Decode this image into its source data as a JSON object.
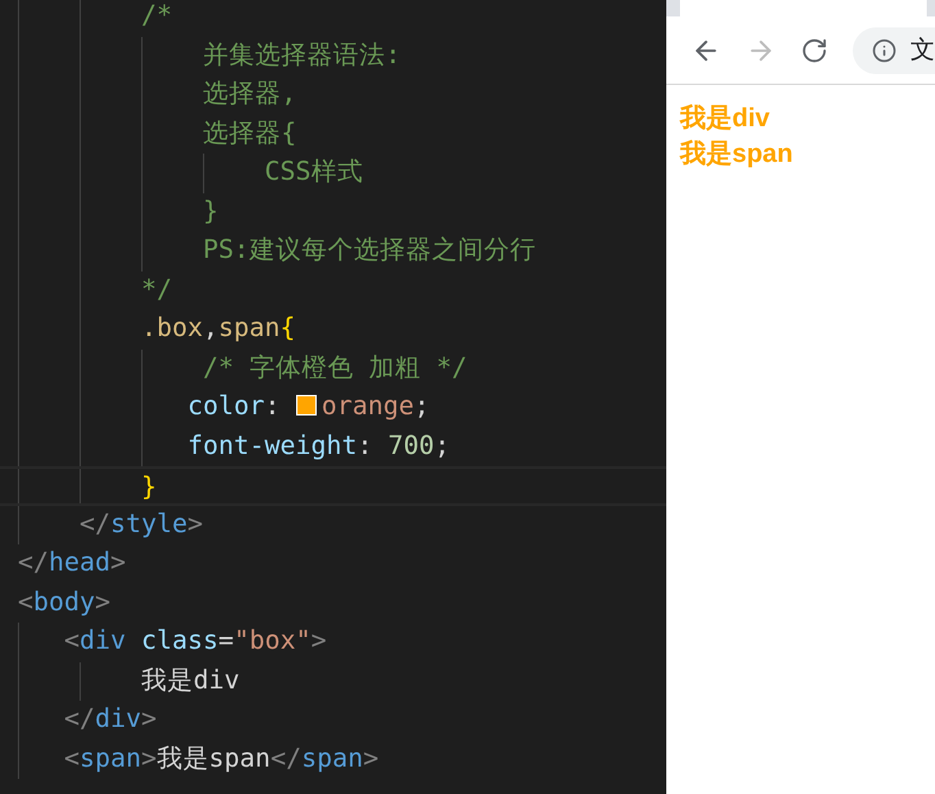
{
  "editor": {
    "lines": [
      {
        "current": false,
        "tokens": [
          {
            "kind": "comment",
            "text": "        /*"
          }
        ]
      },
      {
        "current": false,
        "tokens": [
          {
            "kind": "comment",
            "text": "            并集选择器语法:"
          }
        ]
      },
      {
        "current": false,
        "tokens": [
          {
            "kind": "comment",
            "text": "            选择器,"
          }
        ]
      },
      {
        "current": false,
        "tokens": [
          {
            "kind": "comment",
            "text": "            选择器{"
          }
        ]
      },
      {
        "current": false,
        "tokens": [
          {
            "kind": "comment",
            "text": "                CSS样式"
          }
        ]
      },
      {
        "current": false,
        "tokens": [
          {
            "kind": "comment",
            "text": "            }"
          }
        ]
      },
      {
        "current": false,
        "tokens": [
          {
            "kind": "comment",
            "text": "            PS:建议每个选择器之间分行"
          }
        ]
      },
      {
        "current": false,
        "tokens": [
          {
            "kind": "comment",
            "text": "        */"
          }
        ]
      },
      {
        "current": false,
        "tokens": [
          {
            "kind": "selector",
            "text": "        .box"
          },
          {
            "kind": "plain",
            "text": ","
          },
          {
            "kind": "selector",
            "text": "span"
          },
          {
            "kind": "brace",
            "text": "{"
          }
        ]
      },
      {
        "current": false,
        "tokens": [
          {
            "kind": "comment",
            "text": "            /* 字体橙色 加粗 */"
          }
        ]
      },
      {
        "current": false,
        "tokens": [
          {
            "kind": "property",
            "text": "           color"
          },
          {
            "kind": "plain",
            "text": ": "
          },
          {
            "kind": "swatch",
            "color": "#ffa500"
          },
          {
            "kind": "value",
            "text": "orange"
          },
          {
            "kind": "plain",
            "text": ";"
          }
        ]
      },
      {
        "current": false,
        "tokens": [
          {
            "kind": "property",
            "text": "           font-weight"
          },
          {
            "kind": "plain",
            "text": ": "
          },
          {
            "kind": "number",
            "text": "700"
          },
          {
            "kind": "plain",
            "text": ";"
          }
        ]
      },
      {
        "current": true,
        "tokens": [
          {
            "kind": "brace",
            "text": "        }"
          }
        ]
      },
      {
        "current": false,
        "tokens": [
          {
            "kind": "bracket",
            "text": "    </"
          },
          {
            "kind": "tag",
            "text": "style"
          },
          {
            "kind": "bracket",
            "text": ">"
          }
        ]
      },
      {
        "current": false,
        "tokens": [
          {
            "kind": "bracket",
            "text": "</"
          },
          {
            "kind": "tag",
            "text": "head"
          },
          {
            "kind": "bracket",
            "text": ">"
          }
        ]
      },
      {
        "current": false,
        "tokens": [
          {
            "kind": "bracket",
            "text": "<"
          },
          {
            "kind": "tag",
            "text": "body"
          },
          {
            "kind": "bracket",
            "text": ">"
          }
        ]
      },
      {
        "current": false,
        "tokens": [
          {
            "kind": "bracket",
            "text": "   <"
          },
          {
            "kind": "tag",
            "text": "div"
          },
          {
            "kind": "attr",
            "text": " class"
          },
          {
            "kind": "plain",
            "text": "="
          },
          {
            "kind": "string",
            "text": "\"box\""
          },
          {
            "kind": "bracket",
            "text": ">"
          }
        ]
      },
      {
        "current": false,
        "tokens": [
          {
            "kind": "plain",
            "text": "        我是div"
          }
        ]
      },
      {
        "current": false,
        "tokens": [
          {
            "kind": "bracket",
            "text": "   </"
          },
          {
            "kind": "tag",
            "text": "div"
          },
          {
            "kind": "bracket",
            "text": ">"
          }
        ]
      },
      {
        "current": false,
        "tokens": [
          {
            "kind": "bracket",
            "text": "   <"
          },
          {
            "kind": "tag",
            "text": "span"
          },
          {
            "kind": "bracket",
            "text": ">"
          },
          {
            "kind": "plain",
            "text": "我是span"
          },
          {
            "kind": "bracket",
            "text": "</"
          },
          {
            "kind": "tag",
            "text": "span"
          },
          {
            "kind": "bracket",
            "text": ">"
          }
        ]
      }
    ]
  },
  "browser": {
    "address": "文",
    "lines": [
      "我是div",
      "我是span"
    ]
  }
}
